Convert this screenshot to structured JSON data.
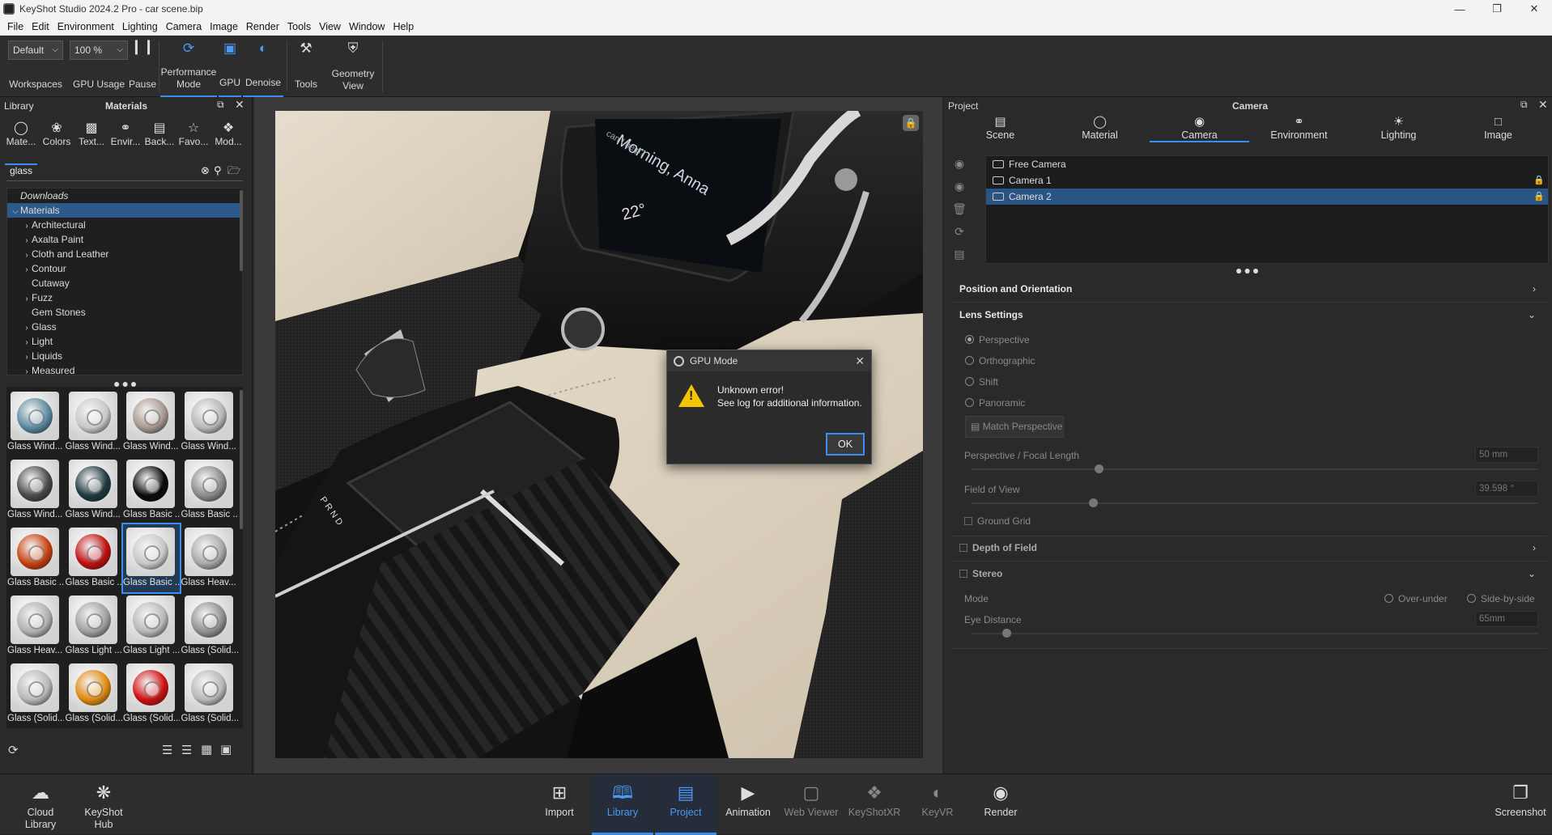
{
  "window": {
    "title": "KeyShot Studio 2024.2 Pro  - car scene.bip"
  },
  "menu": [
    "File",
    "Edit",
    "Environment",
    "Lighting",
    "Camera",
    "Image",
    "Render",
    "Tools",
    "View",
    "Window",
    "Help"
  ],
  "toolbar": {
    "workspace_value": "Default",
    "zoom_value": "100 %",
    "workspaces_label": "Workspaces",
    "gpu_usage_label": "GPU Usage",
    "pause_label": "Pause",
    "performance_label_1": "Performance",
    "performance_label_2": "Mode",
    "gpu_label": "GPU",
    "denoise_label": "Denoise",
    "tools_label": "Tools",
    "geometry_label_1": "Geometry",
    "geometry_label_2": "View"
  },
  "library": {
    "panel_title": "Library",
    "section_title": "Materials",
    "tabs": [
      "Mate...",
      "Colors",
      "Text...",
      "Envir...",
      "Back...",
      "Favo...",
      "Mod..."
    ],
    "search_value": "glass",
    "tree": [
      {
        "label": "Downloads",
        "expanded": false,
        "italic": true,
        "indent": 0
      },
      {
        "label": "Materials",
        "expanded": true,
        "selected": true,
        "indent": 0
      },
      {
        "label": "Architectural",
        "arrow": true,
        "indent": 1
      },
      {
        "label": "Axalta Paint",
        "arrow": true,
        "indent": 1
      },
      {
        "label": "Cloth and Leather",
        "arrow": true,
        "indent": 1
      },
      {
        "label": "Contour",
        "arrow": true,
        "indent": 1
      },
      {
        "label": "Cutaway",
        "arrow": false,
        "indent": 1
      },
      {
        "label": "Fuzz",
        "arrow": true,
        "indent": 1
      },
      {
        "label": "Gem Stones",
        "arrow": false,
        "indent": 1
      },
      {
        "label": "Glass",
        "arrow": true,
        "indent": 1
      },
      {
        "label": "Light",
        "arrow": true,
        "indent": 1
      },
      {
        "label": "Liquids",
        "arrow": true,
        "indent": 1
      },
      {
        "label": "Measured",
        "arrow": true,
        "indent": 1
      }
    ],
    "thumbnails": [
      {
        "label": "Glass Wind...",
        "color": "#5a8aa0"
      },
      {
        "label": "Glass Wind...",
        "color": "#c8c8c8"
      },
      {
        "label": "Glass Wind...",
        "color": "#a89890"
      },
      {
        "label": "Glass Wind...",
        "color": "#b8b8b8"
      },
      {
        "label": "Glass Wind...",
        "color": "#4a4a4a"
      },
      {
        "label": "Glass Wind...",
        "color": "#1e3a40"
      },
      {
        "label": "Glass Basic ...",
        "color": "#0a0a0a"
      },
      {
        "label": "Glass Basic ...",
        "color": "#8a8a8a"
      },
      {
        "label": "Glass Basic ...",
        "color": "#c84010"
      },
      {
        "label": "Glass Basic ...",
        "color": "#c01010"
      },
      {
        "label": "Glass Basic ...",
        "color": "#c8c8c8",
        "selected": true
      },
      {
        "label": "Glass Heav...",
        "color": "#a8a8a8"
      },
      {
        "label": "Glass Heav...",
        "color": "#b0b0b0"
      },
      {
        "label": "Glass Light ...",
        "color": "#a0a0a0"
      },
      {
        "label": "Glass Light ...",
        "color": "#b8b8b8"
      },
      {
        "label": "Glass (Solid...",
        "color": "#909090"
      },
      {
        "label": "Glass (Solid...",
        "color": "#b8b8b8"
      },
      {
        "label": "Glass (Solid...",
        "color": "#e08a10"
      },
      {
        "label": "Glass (Solid...",
        "color": "#d01010"
      },
      {
        "label": "Glass (Solid...",
        "color": "#b8b8b8"
      }
    ]
  },
  "viewport": {
    "screen_text_1": "Morning, Anna",
    "screen_text_2": "can I help?",
    "screen_temp": "22°",
    "gear_letters": "P R N D"
  },
  "dialog": {
    "title": "GPU Mode",
    "line1": "Unknown error!",
    "line2": "See log for additional information.",
    "ok_label": "OK"
  },
  "project": {
    "panel_title": "Project",
    "section_title": "Camera",
    "tabs": [
      "Scene",
      "Material",
      "Camera",
      "Environment",
      "Lighting",
      "Image"
    ],
    "active_tab": "Camera",
    "cameras": [
      {
        "name": "Free Camera",
        "locked": false
      },
      {
        "name": "Camera 1",
        "locked": true
      },
      {
        "name": "Camera 2",
        "locked": true,
        "selected": true
      }
    ],
    "position_section": "Position and Orientation",
    "lens_section": "Lens Settings",
    "projection_options": [
      "Perspective",
      "Orthographic",
      "Shift",
      "Panoramic"
    ],
    "projection_selected": "Perspective",
    "match_perspective_label": "Match Perspective",
    "focal_label": "Perspective / Focal Length",
    "focal_value": "50 mm",
    "fov_label": "Field of View",
    "fov_value": "39.598 °",
    "ground_grid_label": "Ground Grid",
    "dof_section": "Depth of Field",
    "stereo_section": "Stereo",
    "mode_label": "Mode",
    "mode_options": [
      "Over-under",
      "Side-by-side"
    ],
    "eye_distance_label": "Eye Distance",
    "eye_distance_value": "65mm"
  },
  "bottom": {
    "cloud_library_1": "Cloud",
    "cloud_library_2": "Library",
    "hub_1": "KeyShot",
    "hub_2": "Hub",
    "import": "Import",
    "library": "Library",
    "project": "Project",
    "animation": "Animation",
    "web_viewer": "Web Viewer",
    "keyshotxr": "KeyShotXR",
    "keyvr": "KeyVR",
    "render": "Render",
    "screenshot": "Screenshot"
  },
  "colors": {
    "accent": "#3d8cf0",
    "selection": "#2a5484",
    "warning": "#f5c400"
  }
}
